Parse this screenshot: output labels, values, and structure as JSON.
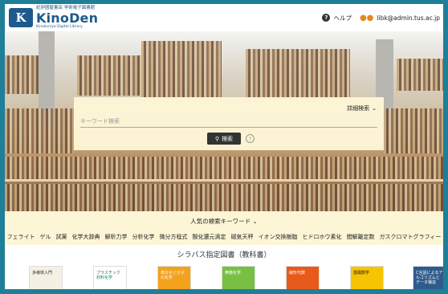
{
  "header": {
    "logo_sub": "紀伊國屋書店 学術電子図書館",
    "logo_mark": "K",
    "logo_name": "KinoDen",
    "logo_en": "Kinokuniya Digital Library",
    "help_label": "ヘルプ",
    "user_email": "libk@admin.tus.ac.jp"
  },
  "search": {
    "detail_label": "詳細検索",
    "placeholder": "キーワード検索",
    "button_label": "検索",
    "help_glyph": "?"
  },
  "popular": {
    "title": "人気の検索キーワード",
    "keywords": [
      "フェライト",
      "ゲル",
      "試薬",
      "化学大辞典",
      "解析力学",
      "分析化学",
      "微分方程式",
      "酸化還元滴定",
      "磁気天秤",
      "イオン交換樹脂",
      "ヒドロホウ素化",
      "錯解離定数",
      "ガスクロマトグラフィー"
    ]
  },
  "syllabus": {
    "title": "シラバス指定図書（教科書）",
    "books": [
      {
        "title": "多様体入門",
        "color": "#f4f0e4",
        "text_color": "#222"
      },
      {
        "title": "プラスチック材料化学",
        "color": "#ffffff",
        "text_color": "#1a7a6a"
      },
      {
        "title": "高分子と分子の化学",
        "color": "#f3a21c",
        "text_color": "#fff"
      },
      {
        "title": "無機化学",
        "color": "#77c043",
        "text_color": "#fff"
      },
      {
        "title": "線形代数",
        "color": "#e85a1a",
        "text_color": "#fff"
      },
      {
        "title": "基礎数学",
        "color": "#f6c400",
        "text_color": "#222"
      },
      {
        "title": "C言語によるアルゴリズムとデータ構造",
        "color": "#2e5b8c",
        "text_color": "#fff"
      }
    ]
  },
  "colors": {
    "frame": "#1f7e98",
    "brand": "#1e5a8c",
    "panel": "#fdf6d6",
    "user_icon": "#e08a1e"
  }
}
